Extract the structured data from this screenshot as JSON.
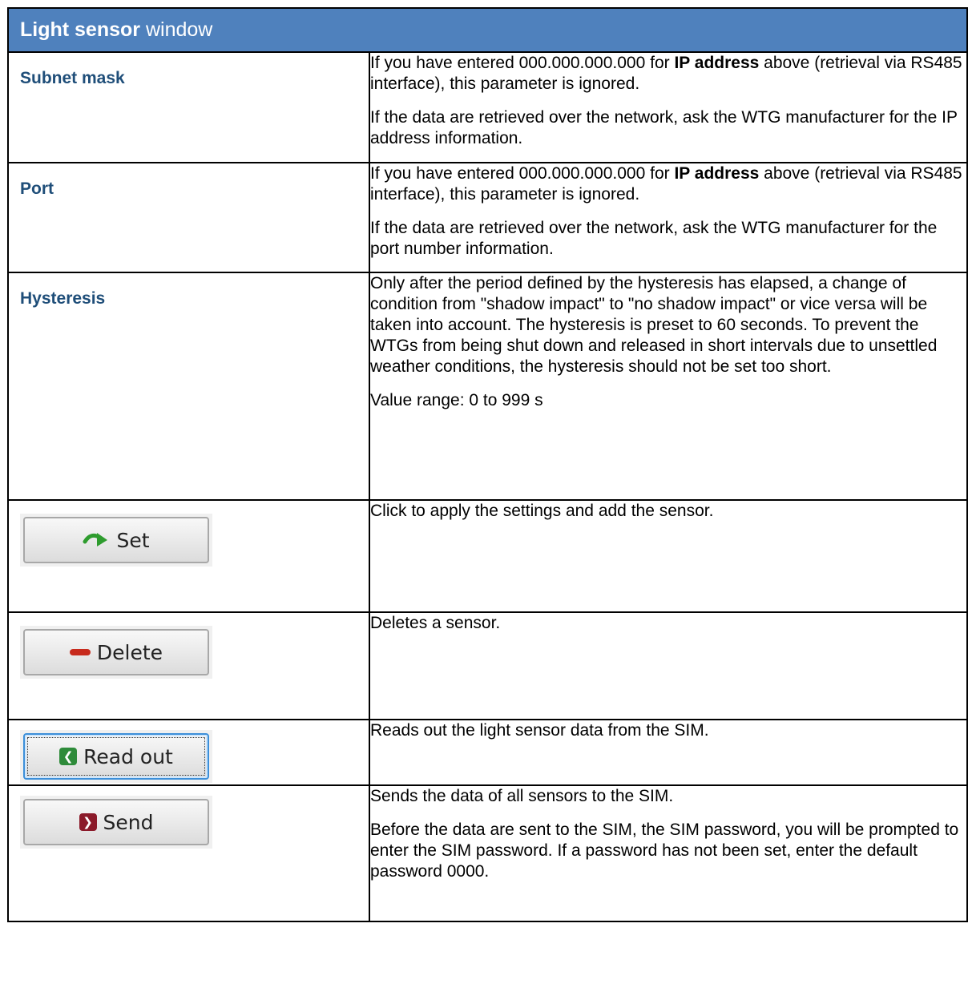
{
  "header": {
    "bold": "Light sensor",
    "rest": " window"
  },
  "params": [
    {
      "name": "Subnet mask",
      "p1_pre": "If you have entered 000.000.000.000 for ",
      "p1_bold": "IP address",
      "p1_post": " above (retrieval via RS485 interface), this parameter is ignored.",
      "p2": "If the data are retrieved over the network, ask the WTG manufacturer for the IP address information."
    },
    {
      "name": "Port",
      "p1_pre": "If you have entered 000.000.000.000 for ",
      "p1_bold": "IP address",
      "p1_post": " above (retrieval via RS485 interface), this parameter is ignored.",
      "p2": "If the data are retrieved over the network, ask the WTG manufacturer for the port number information."
    },
    {
      "name": "Hysteresis",
      "p1": "Only after the period defined by the hysteresis has elapsed, a change of condition from \"shadow impact\" to \"no shadow impact\" or vice versa will be taken into account. The hysteresis is preset to 60 seconds. To prevent the WTGs from being shut down and released in short intervals due to unsettled weather conditions, the hysteresis should not be set too short.",
      "p2": "Value range: 0 to 999 s"
    }
  ],
  "buttons": [
    {
      "label": "Set",
      "icon": "green-curved-arrow-icon",
      "desc": "Click to apply the settings and add the sensor."
    },
    {
      "label": "Delete",
      "icon": "red-minus-icon",
      "desc": "Deletes a sensor."
    },
    {
      "label": "Read out",
      "icon": "green-back-arrow-icon",
      "desc": "Reads out the light sensor data from the SIM."
    },
    {
      "label": "Send",
      "icon": "red-forward-arrow-icon",
      "desc": "Sends the data of all sensors to the SIM.",
      "desc2": "Before the data are sent to the SIM, the SIM password, you will be prompted to enter the SIM password. If a password has not been set, enter the default password 0000."
    }
  ]
}
